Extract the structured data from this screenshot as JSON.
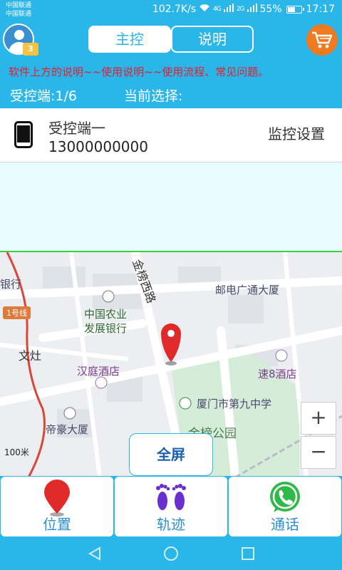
{
  "status_bar": {
    "carrier_1": "中国联通",
    "carrier_2": "中国联通",
    "speed": "102.7K/s",
    "signal_1": "4G",
    "signal_2": "2G",
    "battery": "55%",
    "time": "17:17"
  },
  "header": {
    "tab_main": "主控",
    "tab_help": "说明",
    "vip_badge": "3",
    "notice": "软件上方的说明~~使用说明~~使用流程、常见问题。",
    "receiver_count": "受控端:1/6",
    "current_selection": "当前选择:"
  },
  "device": {
    "name": "受控端一",
    "phone": "13000000000",
    "settings_label": "监控设置"
  },
  "map": {
    "labels": {
      "road": "金榜西路",
      "bank_fragment": "银行",
      "line1": "1号线",
      "abc_bank_1": "中国农业",
      "abc_bank_2": "发展银行",
      "post_building": "邮电广通大厦",
      "wenzao": "文灶",
      "hanting": "汉庭酒店",
      "super8": "速8酒店",
      "school": "厦门市第九中学",
      "dihao": "帝豪大厦",
      "park": "金榜公园"
    },
    "scale": "100米",
    "zoom_in": "+",
    "zoom_out": "−",
    "fullscreen": "全屏"
  },
  "bottom_buttons": {
    "location": "位置",
    "track": "轨迹",
    "call": "通话"
  },
  "colors": {
    "primary": "#2bb6ea",
    "notice": "#e0202e",
    "accent_cart": "#f07a20",
    "pin": "#e02a2a",
    "track": "#6b2fd0",
    "phone": "#2fb94a"
  }
}
